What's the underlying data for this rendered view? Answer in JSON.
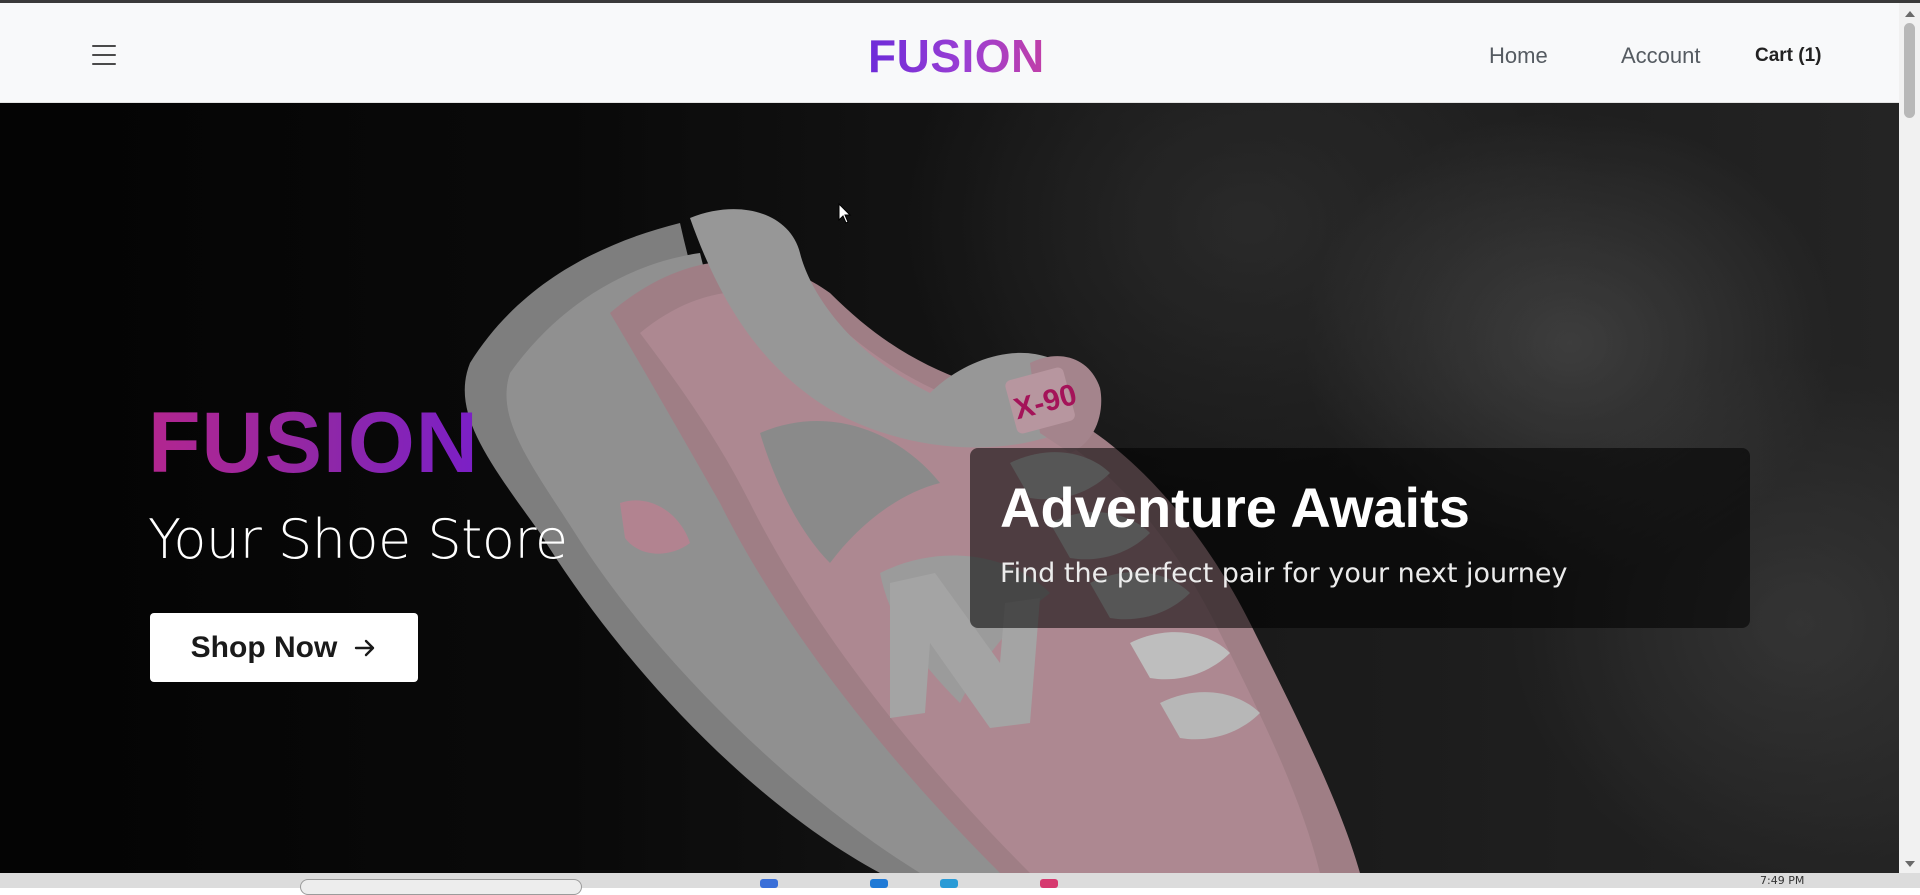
{
  "navbar": {
    "brand": "FUSION",
    "links": {
      "home": "Home",
      "account": "Account",
      "cart": "Cart (1)"
    }
  },
  "hero": {
    "brand": "FUSION",
    "tagline": "Your Shoe Store",
    "cta_label": "Shop Now",
    "promo": {
      "title": "Adventure Awaits",
      "subtitle": "Find the perfect pair for your next journey"
    },
    "shoe_badge": "X-90"
  },
  "taskbar": {
    "time": "7:49 PM"
  },
  "colors": {
    "brand_gradient_start": "#6d2bd9",
    "brand_gradient_end": "#c13fa8",
    "hero_brand_start": "#b3268f",
    "hero_brand_end": "#7b1fc7",
    "navbar_bg": "#f8f9fa",
    "cta_bg": "#ffffff"
  },
  "icons": {
    "menu": "hamburger-icon",
    "cta_arrow": "arrow-right-icon"
  }
}
